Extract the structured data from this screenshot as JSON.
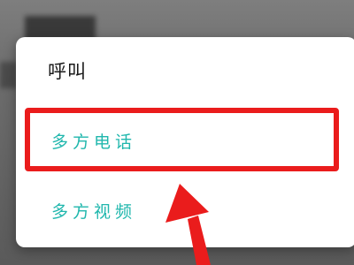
{
  "dialog": {
    "title": "呼叫",
    "items": [
      {
        "label": "多方电话",
        "highlighted": true
      },
      {
        "label": "多方视频",
        "highlighted": false
      }
    ]
  },
  "annotation": {
    "highlight_color": "#ea1c1c",
    "arrow_color": "#ea1c1c",
    "accent_text_color": "#20b7ad",
    "arrow_icon": "red-arrow-pointer"
  }
}
